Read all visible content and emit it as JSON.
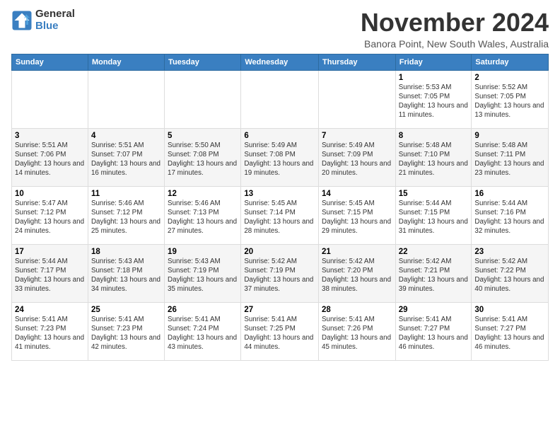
{
  "logo": {
    "general": "General",
    "blue": "Blue"
  },
  "header": {
    "month": "November 2024",
    "location": "Banora Point, New South Wales, Australia"
  },
  "weekdays": [
    "Sunday",
    "Monday",
    "Tuesday",
    "Wednesday",
    "Thursday",
    "Friday",
    "Saturday"
  ],
  "weeks": [
    [
      {
        "day": "",
        "info": ""
      },
      {
        "day": "",
        "info": ""
      },
      {
        "day": "",
        "info": ""
      },
      {
        "day": "",
        "info": ""
      },
      {
        "day": "",
        "info": ""
      },
      {
        "day": "1",
        "info": "Sunrise: 5:53 AM\nSunset: 7:05 PM\nDaylight: 13 hours and 11 minutes."
      },
      {
        "day": "2",
        "info": "Sunrise: 5:52 AM\nSunset: 7:05 PM\nDaylight: 13 hours and 13 minutes."
      }
    ],
    [
      {
        "day": "3",
        "info": "Sunrise: 5:51 AM\nSunset: 7:06 PM\nDaylight: 13 hours and 14 minutes."
      },
      {
        "day": "4",
        "info": "Sunrise: 5:51 AM\nSunset: 7:07 PM\nDaylight: 13 hours and 16 minutes."
      },
      {
        "day": "5",
        "info": "Sunrise: 5:50 AM\nSunset: 7:08 PM\nDaylight: 13 hours and 17 minutes."
      },
      {
        "day": "6",
        "info": "Sunrise: 5:49 AM\nSunset: 7:08 PM\nDaylight: 13 hours and 19 minutes."
      },
      {
        "day": "7",
        "info": "Sunrise: 5:49 AM\nSunset: 7:09 PM\nDaylight: 13 hours and 20 minutes."
      },
      {
        "day": "8",
        "info": "Sunrise: 5:48 AM\nSunset: 7:10 PM\nDaylight: 13 hours and 21 minutes."
      },
      {
        "day": "9",
        "info": "Sunrise: 5:48 AM\nSunset: 7:11 PM\nDaylight: 13 hours and 23 minutes."
      }
    ],
    [
      {
        "day": "10",
        "info": "Sunrise: 5:47 AM\nSunset: 7:12 PM\nDaylight: 13 hours and 24 minutes."
      },
      {
        "day": "11",
        "info": "Sunrise: 5:46 AM\nSunset: 7:12 PM\nDaylight: 13 hours and 25 minutes."
      },
      {
        "day": "12",
        "info": "Sunrise: 5:46 AM\nSunset: 7:13 PM\nDaylight: 13 hours and 27 minutes."
      },
      {
        "day": "13",
        "info": "Sunrise: 5:45 AM\nSunset: 7:14 PM\nDaylight: 13 hours and 28 minutes."
      },
      {
        "day": "14",
        "info": "Sunrise: 5:45 AM\nSunset: 7:15 PM\nDaylight: 13 hours and 29 minutes."
      },
      {
        "day": "15",
        "info": "Sunrise: 5:44 AM\nSunset: 7:15 PM\nDaylight: 13 hours and 31 minutes."
      },
      {
        "day": "16",
        "info": "Sunrise: 5:44 AM\nSunset: 7:16 PM\nDaylight: 13 hours and 32 minutes."
      }
    ],
    [
      {
        "day": "17",
        "info": "Sunrise: 5:44 AM\nSunset: 7:17 PM\nDaylight: 13 hours and 33 minutes."
      },
      {
        "day": "18",
        "info": "Sunrise: 5:43 AM\nSunset: 7:18 PM\nDaylight: 13 hours and 34 minutes."
      },
      {
        "day": "19",
        "info": "Sunrise: 5:43 AM\nSunset: 7:19 PM\nDaylight: 13 hours and 35 minutes."
      },
      {
        "day": "20",
        "info": "Sunrise: 5:42 AM\nSunset: 7:19 PM\nDaylight: 13 hours and 37 minutes."
      },
      {
        "day": "21",
        "info": "Sunrise: 5:42 AM\nSunset: 7:20 PM\nDaylight: 13 hours and 38 minutes."
      },
      {
        "day": "22",
        "info": "Sunrise: 5:42 AM\nSunset: 7:21 PM\nDaylight: 13 hours and 39 minutes."
      },
      {
        "day": "23",
        "info": "Sunrise: 5:42 AM\nSunset: 7:22 PM\nDaylight: 13 hours and 40 minutes."
      }
    ],
    [
      {
        "day": "24",
        "info": "Sunrise: 5:41 AM\nSunset: 7:23 PM\nDaylight: 13 hours and 41 minutes."
      },
      {
        "day": "25",
        "info": "Sunrise: 5:41 AM\nSunset: 7:23 PM\nDaylight: 13 hours and 42 minutes."
      },
      {
        "day": "26",
        "info": "Sunrise: 5:41 AM\nSunset: 7:24 PM\nDaylight: 13 hours and 43 minutes."
      },
      {
        "day": "27",
        "info": "Sunrise: 5:41 AM\nSunset: 7:25 PM\nDaylight: 13 hours and 44 minutes."
      },
      {
        "day": "28",
        "info": "Sunrise: 5:41 AM\nSunset: 7:26 PM\nDaylight: 13 hours and 45 minutes."
      },
      {
        "day": "29",
        "info": "Sunrise: 5:41 AM\nSunset: 7:27 PM\nDaylight: 13 hours and 46 minutes."
      },
      {
        "day": "30",
        "info": "Sunrise: 5:41 AM\nSunset: 7:27 PM\nDaylight: 13 hours and 46 minutes."
      }
    ]
  ]
}
